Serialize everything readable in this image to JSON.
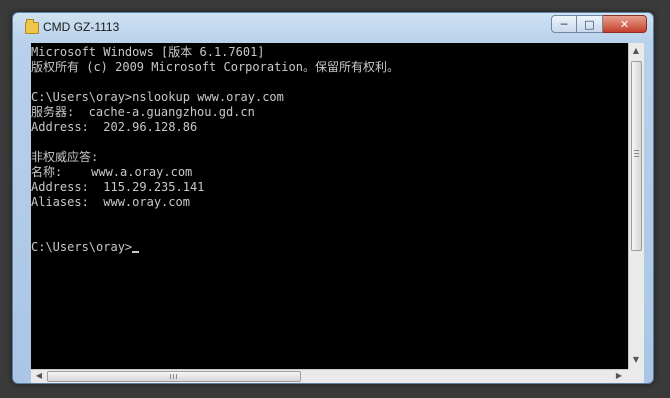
{
  "window": {
    "title": "CMD GZ-1113",
    "minimize_label": "─",
    "maximize_label": "□",
    "close_label": "✕"
  },
  "console": {
    "lines": [
      "Microsoft Windows [版本 6.1.7601]",
      "版权所有 (c) 2009 Microsoft Corporation。保留所有权利。",
      "",
      "C:\\Users\\oray>nslookup www.oray.com",
      "服务器:  cache-a.guangzhou.gd.cn",
      "Address:  202.96.128.86",
      "",
      "非权威应答:",
      "名称:    www.a.oray.com",
      "Address:  115.29.235.141",
      "Aliases:  www.oray.com",
      "",
      "",
      "C:\\Users\\oray>"
    ]
  },
  "scrollbars": {
    "up_arrow": "▲",
    "down_arrow": "▼",
    "left_arrow": "◀",
    "right_arrow": "▶"
  },
  "icons": {
    "window_icon": "folder-icon"
  }
}
